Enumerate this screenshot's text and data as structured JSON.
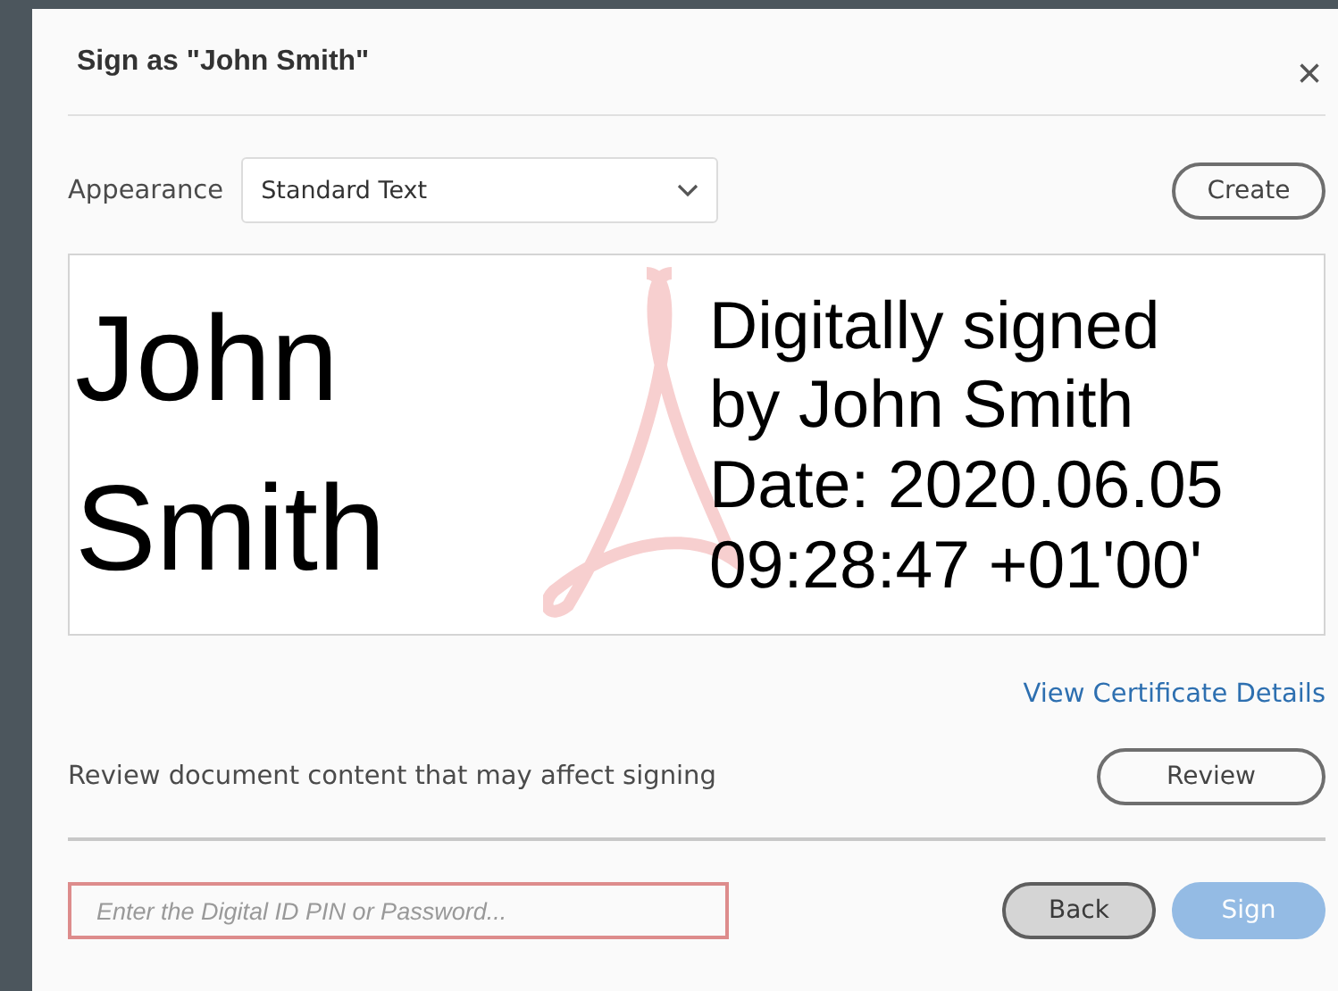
{
  "dialog": {
    "title": "Sign as \"John Smith\"",
    "close": "×"
  },
  "appearance": {
    "label": "Appearance",
    "value": "Standard Text",
    "button": "Create"
  },
  "preview": {
    "name_lines": [
      "John",
      "Smith"
    ],
    "detail_lines": [
      "Digitally signed",
      "by John Smith",
      "Date: 2020.06.05",
      "09:28:47 +01'00'"
    ]
  },
  "certificate_link": "View Certificate Details",
  "review": {
    "text": "Review document content that may affect signing",
    "button": "Review"
  },
  "pin_field": {
    "placeholder": "Enter the Digital ID PIN or Password...",
    "invalid": true
  },
  "buttons": [
    {
      "label": "Back",
      "kind": "secondary",
      "disabled": false
    },
    {
      "label": "Sign",
      "kind": "primary",
      "disabled": true
    }
  ]
}
